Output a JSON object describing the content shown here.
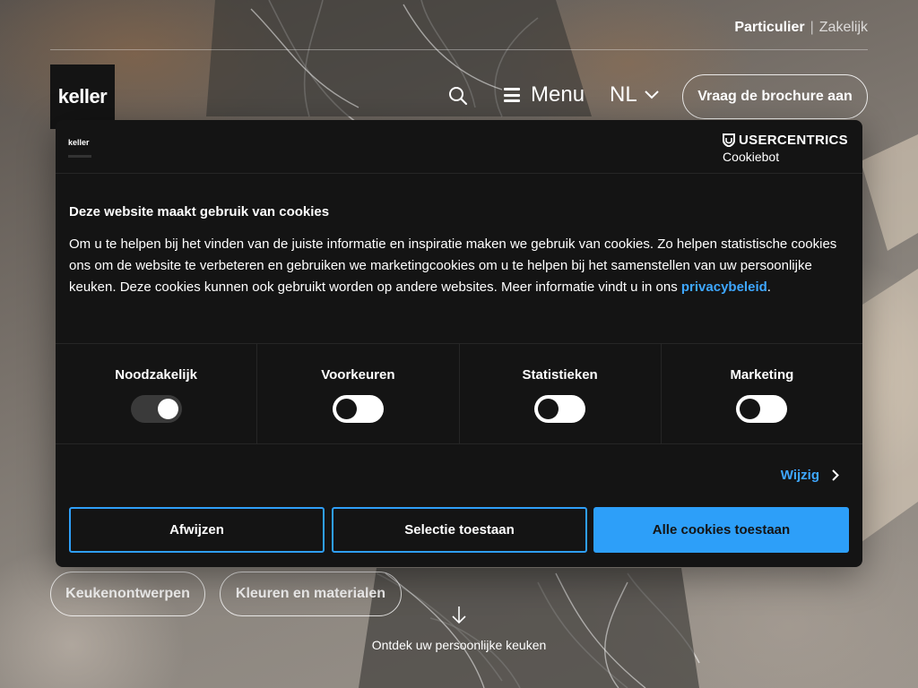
{
  "header": {
    "segment_active": "Particulier",
    "segment_separator": "|",
    "segment_inactive": "Zakelijk",
    "logo_text": "keller",
    "menu_label": "Menu",
    "language": "NL",
    "brochure_button": "Vraag de brochure aan"
  },
  "hero": {
    "pills": [
      "Keukenontwerpen",
      "Kleuren en materialen"
    ],
    "scroll_cta": "Ontdek uw persoonlijke keuken"
  },
  "cookie_banner": {
    "logo_text": "keller",
    "brand_top": "USERCENTRICS",
    "brand_bottom": "Cookiebot",
    "title": "Deze website maakt gebruik van cookies",
    "body": "Om u te helpen bij het vinden van de juiste informatie en inspiratie maken we gebruik van cookies. Zo helpen statistische cookies ons om de website te verbeteren en gebruiken we marketingcookies om u te helpen bij het samenstellen van uw persoonlijke keuken. Deze cookies kunnen ook gebruikt worden op andere websites. Meer informatie vindt u in ons ",
    "privacy_link": "privacybeleid",
    "body_end": ".",
    "categories": [
      {
        "label": "Noodzakelijk",
        "enabled": true
      },
      {
        "label": "Voorkeuren",
        "enabled": false
      },
      {
        "label": "Statistieken",
        "enabled": false
      },
      {
        "label": "Marketing",
        "enabled": false
      }
    ],
    "details_link": "Wijzig",
    "buttons": {
      "reject": "Afwijzen",
      "selection": "Selectie toestaan",
      "accept_all": "Alle cookies toestaan"
    },
    "accent_color": "#2d9ff9"
  }
}
